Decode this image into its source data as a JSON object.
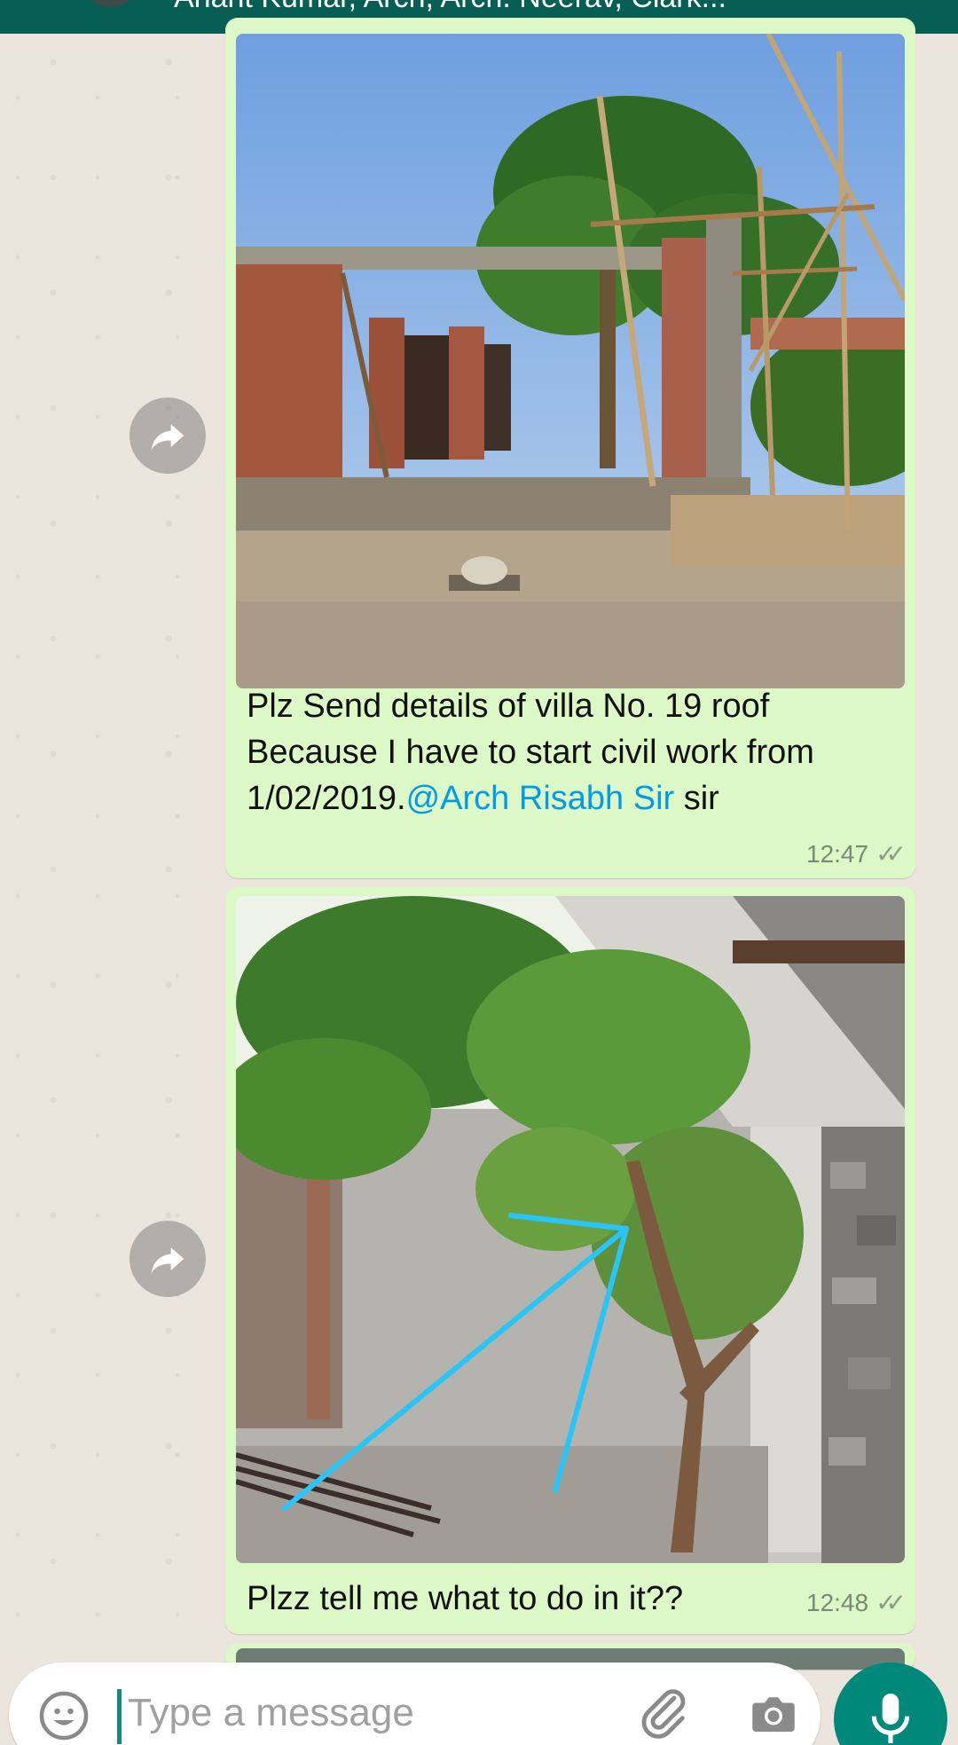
{
  "header": {
    "subtitle": "Anant Kumar, Arch, Arch. Neerav, Clark..."
  },
  "messages": [
    {
      "image": "construction-site-photo",
      "caption_prefix": "Plz Send details of villa No. 19 roof Because I have to start civil work from 1/02/2019.",
      "mention": "@Arch Risabh Sir",
      "caption_suffix": " sir",
      "time": "12:47",
      "status": "read"
    },
    {
      "image": "tree-in-courtyard-photo",
      "caption": "Plzz tell me what to do in it??",
      "time": "12:48",
      "status": "read"
    }
  ],
  "composer": {
    "placeholder": "Type a message"
  },
  "colors": {
    "header": "#075e54",
    "bubble_outgoing": "#dcf8c6",
    "mention": "#039be5",
    "mic_button": "#00897b",
    "arrow_annotation": "#29c5f6"
  },
  "icons": [
    "forward-icon",
    "emoji-icon",
    "attach-icon",
    "camera-icon",
    "mic-icon",
    "double-check-icon"
  ]
}
